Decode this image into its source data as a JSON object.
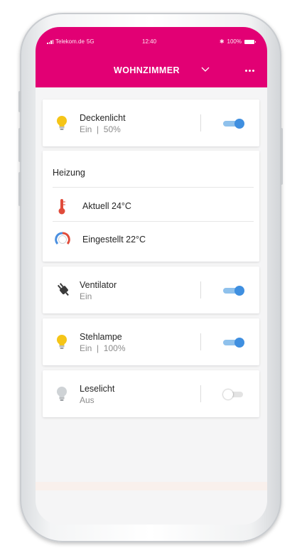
{
  "status_bar": {
    "carrier": "Telekom.de",
    "network": "5G",
    "time": "12:40",
    "bluetooth": "✱",
    "battery": "100%"
  },
  "header": {
    "title": "WOHNZIMMER",
    "color": "#e20074",
    "dropdown_icon": "chevron-down-icon",
    "menu_icon": "more-horizontal-icon"
  },
  "devices": [
    {
      "name": "Deckenlicht",
      "status": "Ein  |  50%",
      "icon": "bulb-on-icon",
      "on": true
    },
    {
      "name": "Ventilator",
      "status": "Ein",
      "icon": "plug-icon",
      "on": true
    },
    {
      "name": "Stehlampe",
      "status": "Ein  |  100%",
      "icon": "bulb-on-icon",
      "on": true
    },
    {
      "name": "Leselicht",
      "status": "Aus",
      "icon": "bulb-off-icon",
      "on": false
    }
  ],
  "heating": {
    "title": "Heizung",
    "current_label": "Aktuell 24°C",
    "set_label": "Eingestellt 22°C",
    "current_icon": "thermometer-icon",
    "set_icon": "thermostat-dial-icon"
  },
  "colors": {
    "toggle_on_knob": "#3f8fe0",
    "toggle_on_track": "#8fc1ec",
    "bulb_on": "#f5c518",
    "bulb_off": "#cfd3d6"
  }
}
